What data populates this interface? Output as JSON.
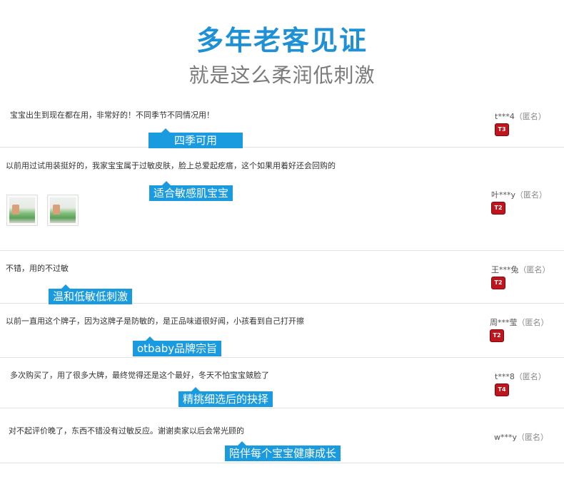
{
  "header": {
    "title": "多年老客见证",
    "subtitle": "就是这么柔润低刺激"
  },
  "reviews": [
    {
      "text": "宝宝出生到现在都在用，非常好的！不同季节不同情况用！",
      "tag": "四季可用",
      "user": "t***4",
      "anon": "（匿名）",
      "badge": "T3",
      "photos": []
    },
    {
      "text": "以前用过试用装挺好的，我家宝宝属于过敏皮肤，脸上总爱起疙瘩，这个如果用着好还会回购的",
      "tag": "适合敏感肌宝宝",
      "user": "叶***y",
      "anon": "（匿名）",
      "badge": "T2",
      "photos": [
        "product-photo-1",
        "product-photo-2"
      ]
    },
    {
      "text": "不错，用的不过敏",
      "tag": "温和低敏低刺激",
      "user": "王***兔",
      "anon": "（匿名）",
      "badge": "T2",
      "photos": []
    },
    {
      "text": "以前一直用这个牌子，因为这牌子是防敏的，是正品味道很好闻，小孩看到自己打开擦",
      "tag": "otbaby品牌宗旨",
      "user": "周***莹",
      "anon": "（匿名）",
      "badge": "T2",
      "photos": []
    },
    {
      "text": "多次购买了，用了很多大牌，最终觉得还是这个最好，冬天不怕宝宝皴脸了",
      "tag": "精挑细选后的抉择",
      "user": "t***8",
      "anon": "（匿名）",
      "badge": "T4",
      "photos": []
    },
    {
      "text": "对不起评价晚了，东西不错没有过敏反应。谢谢卖家以后会常光顾的",
      "tag": "陪伴每个宝宝健康成长",
      "user": "w***y",
      "anon": "（匿名）",
      "badge": "",
      "photos": []
    }
  ],
  "colors": {
    "title": "#1e90d6",
    "subtitle": "#7a7a7a",
    "tag_bg": "#1a9be0",
    "badge_bg": "#c0151c"
  }
}
